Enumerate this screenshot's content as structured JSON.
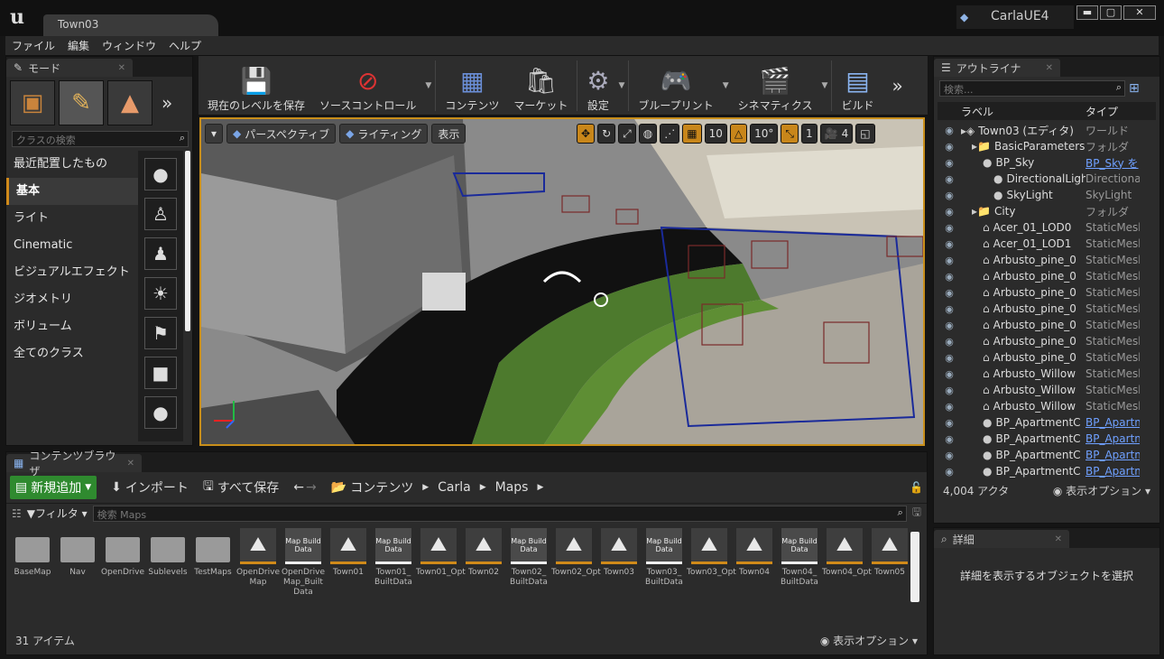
{
  "window": {
    "doc_tab": "Town03",
    "project": "CarlaUE4",
    "min": "▬",
    "max": "▢",
    "close": "✕"
  },
  "menu": [
    "ファイル",
    "編集",
    "ウィンドウ",
    "ヘルプ"
  ],
  "modes": {
    "tab": "モード",
    "search_placeholder": "クラスの検索",
    "categories": [
      "最近配置したもの",
      "基本",
      "ライト",
      "Cinematic",
      "ビジュアルエフェクト",
      "ジオメトリ",
      "ボリューム",
      "全てのクラス"
    ],
    "selected_category": "基本"
  },
  "toolbar": {
    "items": [
      {
        "label": "現在のレベルを保存",
        "icon": "save-icon"
      },
      {
        "label": "ソースコントロール",
        "icon": "source-control-icon"
      },
      {
        "label": "コンテンツ",
        "icon": "content-icon"
      },
      {
        "label": "マーケット",
        "icon": "marketplace-icon"
      },
      {
        "label": "設定",
        "icon": "settings-icon"
      },
      {
        "label": "ブループリント",
        "icon": "blueprint-icon"
      },
      {
        "label": "シネマティクス",
        "icon": "cinematics-icon"
      },
      {
        "label": "ビルド",
        "icon": "build-icon"
      }
    ]
  },
  "viewport": {
    "perspective": "パースペクティブ",
    "lighting": "ライティング",
    "show": "表示",
    "grid_snap": "10",
    "rot_snap": "10°",
    "scale_snap": "1",
    "cam_speed": "4"
  },
  "outliner": {
    "tab": "アウトライナ",
    "search_placeholder": "検索...",
    "col_label": "ラベル",
    "col_type": "タイプ",
    "rows": [
      {
        "label": "Town03 (エディタ)",
        "type": "ワールド",
        "indent": 0,
        "link": false
      },
      {
        "label": "BasicParameters",
        "type": "フォルダ",
        "indent": 1,
        "link": false
      },
      {
        "label": "BP_Sky",
        "type": "BP_Sky を",
        "indent": 2,
        "link": true
      },
      {
        "label": "DirectionalLight",
        "type": "Directional",
        "indent": 3,
        "link": false
      },
      {
        "label": "SkyLight",
        "type": "SkyLight",
        "indent": 3,
        "link": false
      },
      {
        "label": "City",
        "type": "フォルダ",
        "indent": 1,
        "link": false
      },
      {
        "label": "Acer_01_LOD0",
        "type": "StaticMesh",
        "indent": 2,
        "link": false
      },
      {
        "label": "Acer_01_LOD1",
        "type": "StaticMesh",
        "indent": 2,
        "link": false
      },
      {
        "label": "Arbusto_pine_0",
        "type": "StaticMesh",
        "indent": 2,
        "link": false
      },
      {
        "label": "Arbusto_pine_0",
        "type": "StaticMesh",
        "indent": 2,
        "link": false
      },
      {
        "label": "Arbusto_pine_0",
        "type": "StaticMesh",
        "indent": 2,
        "link": false
      },
      {
        "label": "Arbusto_pine_0",
        "type": "StaticMesh",
        "indent": 2,
        "link": false
      },
      {
        "label": "Arbusto_pine_0",
        "type": "StaticMesh",
        "indent": 2,
        "link": false
      },
      {
        "label": "Arbusto_pine_0",
        "type": "StaticMesh",
        "indent": 2,
        "link": false
      },
      {
        "label": "Arbusto_pine_0",
        "type": "StaticMesh",
        "indent": 2,
        "link": false
      },
      {
        "label": "Arbusto_Willow",
        "type": "StaticMesh",
        "indent": 2,
        "link": false
      },
      {
        "label": "Arbusto_Willow",
        "type": "StaticMesh",
        "indent": 2,
        "link": false
      },
      {
        "label": "Arbusto_Willow",
        "type": "StaticMesh",
        "indent": 2,
        "link": false
      },
      {
        "label": "BP_ApartmentC",
        "type": "BP_Apartm",
        "indent": 2,
        "link": true
      },
      {
        "label": "BP_ApartmentC",
        "type": "BP_Apartm",
        "indent": 2,
        "link": true
      },
      {
        "label": "BP_ApartmentC",
        "type": "BP_Apartm",
        "indent": 2,
        "link": true
      },
      {
        "label": "BP_ApartmentC",
        "type": "BP_Apartm",
        "indent": 2,
        "link": true
      }
    ],
    "actor_count": "4,004 アクタ",
    "view_options": "表示オプション"
  },
  "details": {
    "tab": "詳細",
    "message": "詳細を表示するオブジェクトを選択"
  },
  "content_browser": {
    "tab": "コンテンツブラウザ",
    "add_new": "新規追加",
    "import": "インポート",
    "save_all": "すべて保存",
    "path": [
      "コンテンツ",
      "Carla",
      "Maps"
    ],
    "filter": "フィルタ",
    "search_placeholder": "検索 Maps",
    "assets": [
      {
        "name": "BaseMap",
        "kind": "folder"
      },
      {
        "name": "Nav",
        "kind": "folder"
      },
      {
        "name": "OpenDrive",
        "kind": "folder"
      },
      {
        "name": "Sublevels",
        "kind": "folder"
      },
      {
        "name": "TestMaps",
        "kind": "folder"
      },
      {
        "name": "OpenDrive Map",
        "kind": "map"
      },
      {
        "name": "OpenDrive Map_Built Data",
        "kind": "built"
      },
      {
        "name": "Town01",
        "kind": "map"
      },
      {
        "name": "Town01_ BuiltData",
        "kind": "built"
      },
      {
        "name": "Town01_Opt",
        "kind": "map"
      },
      {
        "name": "Town02",
        "kind": "map"
      },
      {
        "name": "Town02_ BuiltData",
        "kind": "built"
      },
      {
        "name": "Town02_Opt",
        "kind": "map"
      },
      {
        "name": "Town03",
        "kind": "map"
      },
      {
        "name": "Town03_ BuiltData",
        "kind": "built"
      },
      {
        "name": "Town03_Opt",
        "kind": "map"
      },
      {
        "name": "Town04",
        "kind": "map"
      },
      {
        "name": "Town04_ BuiltData",
        "kind": "built"
      },
      {
        "name": "Town04_Opt",
        "kind": "map"
      },
      {
        "name": "Town05",
        "kind": "map"
      }
    ],
    "built_label": "Map Build Data",
    "item_count": "31 アイテム",
    "view_options": "表示オプション"
  }
}
